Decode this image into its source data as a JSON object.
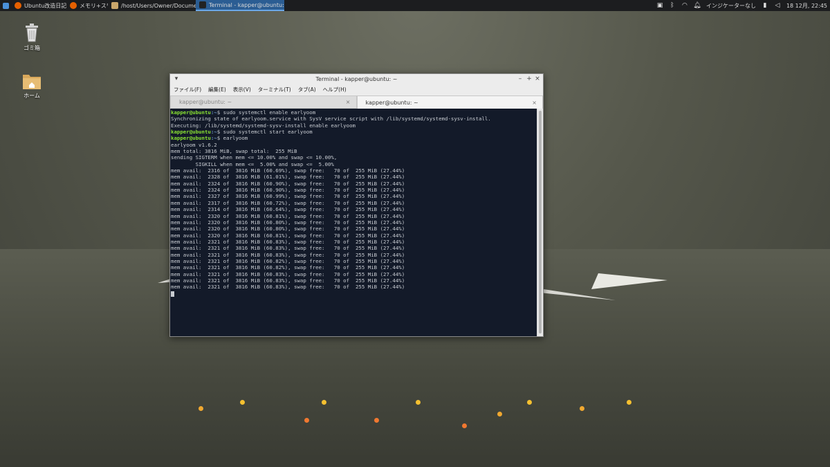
{
  "panel": {
    "tasks": [
      {
        "label": "Ubuntu改造日記",
        "icon": "firefox-icon",
        "color": "#e66000"
      },
      {
        "label": "メモリ+スワ…",
        "icon": "firefox-icon",
        "color": "#e66000"
      },
      {
        "label": "/host/Users/Owner/Docume…",
        "icon": "folder-icon",
        "color": "#c9a66b"
      },
      {
        "label": "Terminal - kapper@ubuntu: ~",
        "icon": "terminal-icon",
        "color": "#222222"
      }
    ],
    "indicator_label": "インジケーターなし",
    "clock": "18 12月, 22:45"
  },
  "desktop": {
    "icons": [
      {
        "label": "ゴミ箱",
        "icon": "trash-icon"
      },
      {
        "label": "ホーム",
        "icon": "home-folder-icon"
      }
    ]
  },
  "window": {
    "title": "Terminal - kapper@ubuntu: ~",
    "menu": [
      "ファイル(F)",
      "編集(E)",
      "表示(V)",
      "ターミナル(T)",
      "タブ(A)",
      "ヘルプ(H)"
    ],
    "tabs": [
      {
        "label": "kapper@ubuntu: ~",
        "active": false
      },
      {
        "label": "kapper@ubuntu: ~",
        "active": true
      }
    ],
    "prompt_user": "kapper@ubuntu",
    "prompt_dir": ":~",
    "lines": [
      {
        "type": "cmd",
        "text": "$ sudo systemctl enable earlyoom"
      },
      {
        "type": "out",
        "text": "Synchronizing state of earlyoom.service with SysV service script with /lib/systemd/systemd-sysv-install."
      },
      {
        "type": "out",
        "text": "Executing: /lib/systemd/systemd-sysv-install enable earlyoom"
      },
      {
        "type": "cmd",
        "text": "$ sudo systemctl start earlyoom"
      },
      {
        "type": "cmd",
        "text": "$ earlyoom"
      },
      {
        "type": "out",
        "text": "earlyoom v1.6.2"
      },
      {
        "type": "out",
        "text": "mem total: 3816 MiB, swap total:  255 MiB"
      },
      {
        "type": "out",
        "text": "sending SIGTERM when mem <= 10.00% and swap <= 10.00%,"
      },
      {
        "type": "out",
        "text": "        SIGKILL when mem <=  5.00% and swap <=  5.00%"
      },
      {
        "type": "out",
        "text": "mem avail:  2316 of  3816 MiB (60.69%), swap free:   70 of  255 MiB (27.44%)"
      },
      {
        "type": "out",
        "text": "mem avail:  2328 of  3816 MiB (61.01%), swap free:   70 of  255 MiB (27.44%)"
      },
      {
        "type": "out",
        "text": "mem avail:  2324 of  3816 MiB (60.90%), swap free:   70 of  255 MiB (27.44%)"
      },
      {
        "type": "out",
        "text": "mem avail:  2324 of  3816 MiB (60.90%), swap free:   70 of  255 MiB (27.44%)"
      },
      {
        "type": "out",
        "text": "mem avail:  2327 of  3816 MiB (60.99%), swap free:   70 of  255 MiB (27.44%)"
      },
      {
        "type": "out",
        "text": "mem avail:  2317 of  3816 MiB (60.72%), swap free:   70 of  255 MiB (27.44%)"
      },
      {
        "type": "out",
        "text": "mem avail:  2314 of  3816 MiB (60.64%), swap free:   70 of  255 MiB (27.44%)"
      },
      {
        "type": "out",
        "text": "mem avail:  2320 of  3816 MiB (60.81%), swap free:   70 of  255 MiB (27.44%)"
      },
      {
        "type": "out",
        "text": "mem avail:  2320 of  3816 MiB (60.80%), swap free:   70 of  255 MiB (27.44%)"
      },
      {
        "type": "out",
        "text": "mem avail:  2320 of  3816 MiB (60.80%), swap free:   70 of  255 MiB (27.44%)"
      },
      {
        "type": "out",
        "text": "mem avail:  2320 of  3816 MiB (60.81%), swap free:   70 of  255 MiB (27.44%)"
      },
      {
        "type": "out",
        "text": "mem avail:  2321 of  3816 MiB (60.83%), swap free:   70 of  255 MiB (27.44%)"
      },
      {
        "type": "out",
        "text": "mem avail:  2321 of  3816 MiB (60.83%), swap free:   70 of  255 MiB (27.44%)"
      },
      {
        "type": "out",
        "text": "mem avail:  2321 of  3816 MiB (60.83%), swap free:   70 of  255 MiB (27.44%)"
      },
      {
        "type": "out",
        "text": "mem avail:  2321 of  3816 MiB (60.82%), swap free:   70 of  255 MiB (27.44%)"
      },
      {
        "type": "out",
        "text": "mem avail:  2321 of  3816 MiB (60.82%), swap free:   70 of  255 MiB (27.44%)"
      },
      {
        "type": "out",
        "text": "mem avail:  2321 of  3816 MiB (60.83%), swap free:   70 of  255 MiB (27.44%)"
      },
      {
        "type": "out",
        "text": "mem avail:  2321 of  3816 MiB (60.83%), swap free:   70 of  255 MiB (27.44%)"
      },
      {
        "type": "out",
        "text": "mem avail:  2321 of  3816 MiB (60.83%), swap free:   70 of  255 MiB (27.44%)"
      }
    ]
  }
}
